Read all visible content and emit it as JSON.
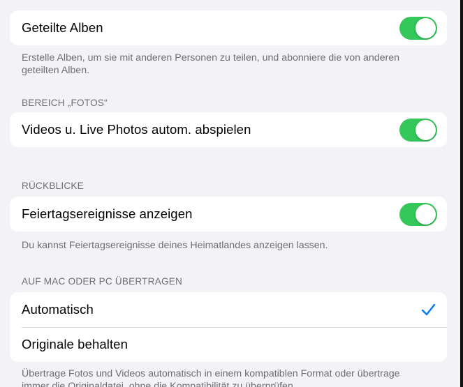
{
  "colors": {
    "toggle_on": "#34c759",
    "checkmark": "#007aff",
    "background": "#f2f2f7",
    "secondary_text": "#6d6d72"
  },
  "shared_albums": {
    "label": "Geteilte Alben",
    "toggle_on": true,
    "footer": "Erstelle Alben, um sie mit anderen Personen zu teilen, und abonniere die von anderen geteilten Alben."
  },
  "photos_section": {
    "header": "BEREICH „FOTOS“",
    "autoplay_label": "Videos u. Live Photos autom. abspielen",
    "autoplay_on": true
  },
  "memories_section": {
    "header": "RÜCKBLICKE",
    "holiday_label": "Feiertagsereignisse anzeigen",
    "holiday_on": true,
    "footer": "Du kannst Feiertagsereignisse deines Heimatlandes anzeigen lassen."
  },
  "transfer_section": {
    "header": "AUF MAC ODER PC ÜBERTRAGEN",
    "options": [
      {
        "label": "Automatisch",
        "selected": true
      },
      {
        "label": "Originale behalten",
        "selected": false
      }
    ],
    "footer": "Übertrage Fotos und Videos automatisch in einem kompatiblen Format oder übertrage immer die Originaldatei, ohne die Kompatibilität zu überprüfen."
  }
}
